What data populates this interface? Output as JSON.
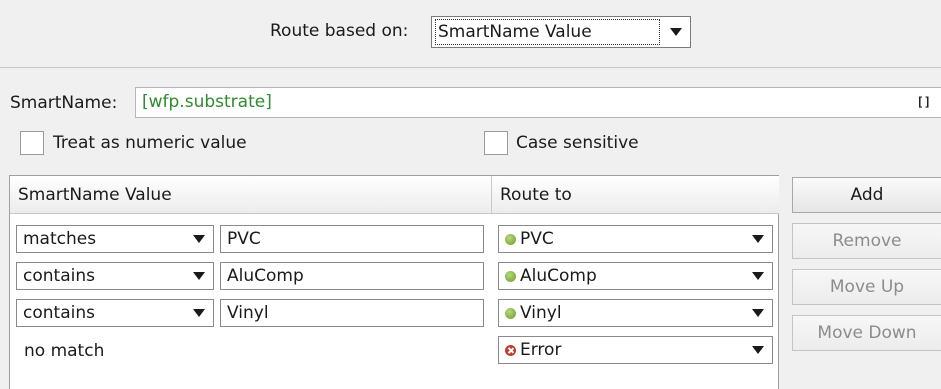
{
  "route": {
    "label": "Route based on:",
    "selected": "SmartName Value"
  },
  "smartname": {
    "label": "SmartName:",
    "value": "[wfp.substrate]",
    "bracket_glyph": "[]"
  },
  "options": {
    "numeric_label": "Treat as numeric value",
    "numeric_checked": false,
    "case_label": "Case sensitive",
    "case_checked": false
  },
  "table": {
    "headers": {
      "value": "SmartName Value",
      "route": "Route to"
    },
    "rows": [
      {
        "operator": "matches",
        "value": "PVC",
        "route": "PVC",
        "route_status": "ok"
      },
      {
        "operator": "contains",
        "value": "AluComp",
        "route": "AluComp",
        "route_status": "ok"
      },
      {
        "operator": "contains",
        "value": "Vinyl",
        "route": "Vinyl",
        "route_status": "ok"
      }
    ],
    "no_match": {
      "label": "no match",
      "route": "Error",
      "route_status": "error"
    }
  },
  "buttons": {
    "add": "Add",
    "remove": "Remove",
    "move_up": "Move Up",
    "move_down": "Move Down"
  },
  "colors": {
    "smartname_value": "#2e8b2e",
    "status_ok": "#6a9a2a",
    "status_error": "#c23b2a",
    "disabled_text": "#8c8c8c"
  },
  "icons": {
    "dropdown": "triangle-down-icon",
    "ok": "green-dot-icon",
    "error": "red-x-circle-icon",
    "expand": "brackets-icon"
  }
}
